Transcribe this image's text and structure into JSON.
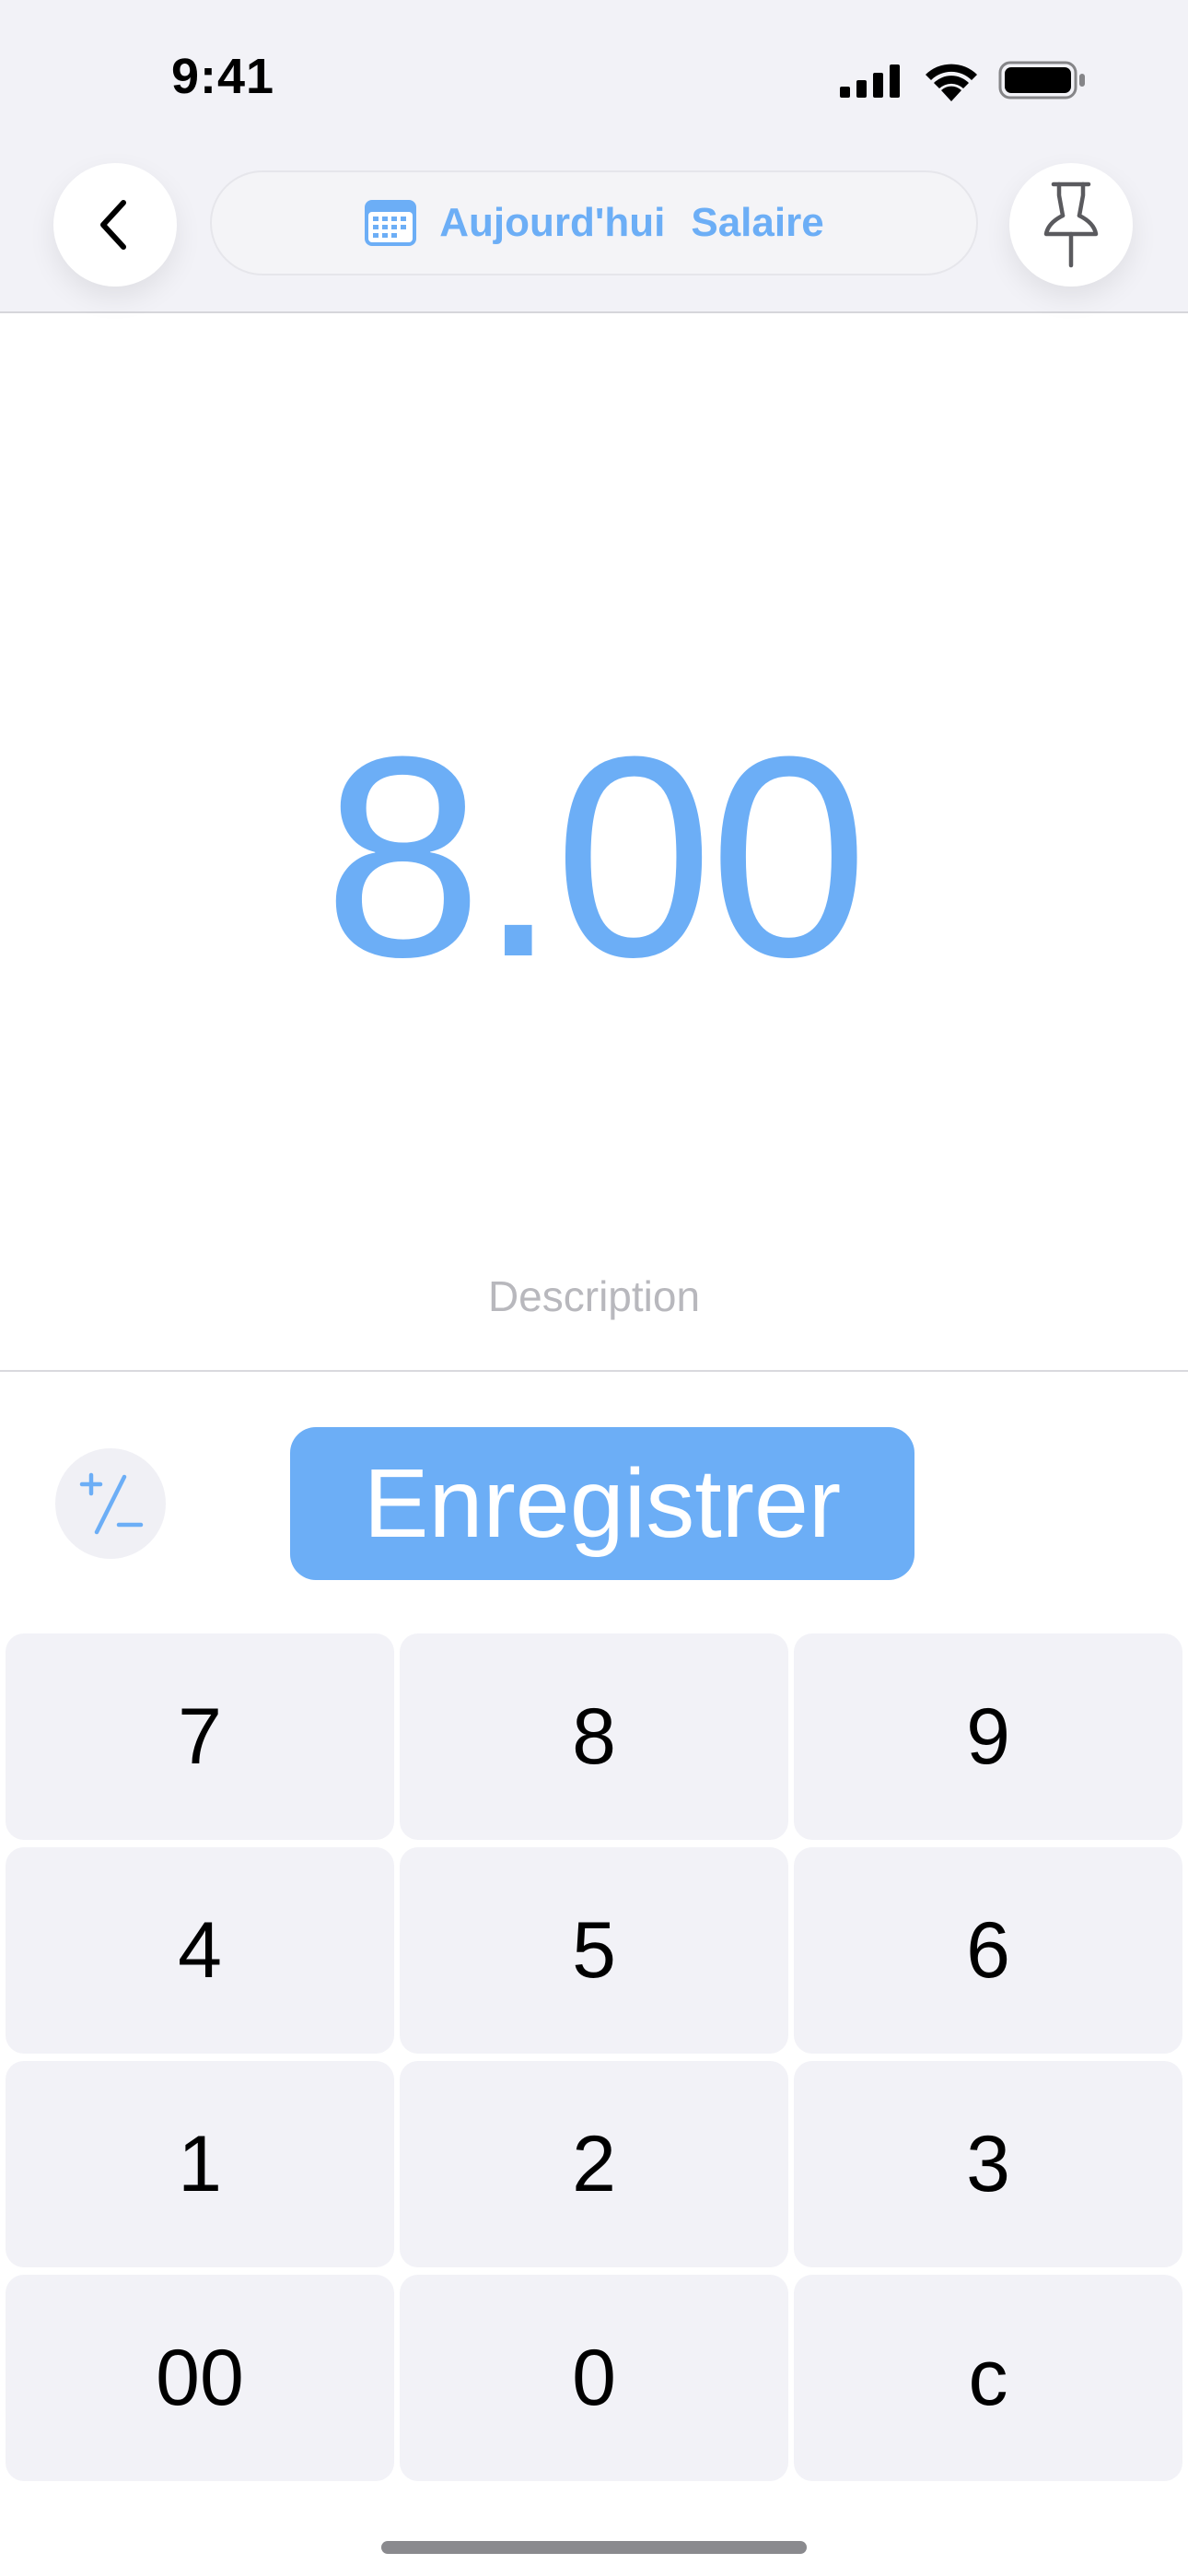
{
  "status_bar": {
    "time": "9:41",
    "icons": [
      "cellular-signal-icon",
      "wifi-icon",
      "battery-icon"
    ]
  },
  "nav": {
    "back_icon": "chevron-left-icon",
    "date_label": "Aujourd'hui",
    "category_label": "Salaire",
    "calendar_icon": "calendar-icon",
    "pin_icon": "pushpin-icon"
  },
  "amount": {
    "value": "8.00"
  },
  "description": {
    "placeholder": "Description"
  },
  "actions": {
    "sign_toggle_icon": "plus-minus-icon",
    "save_label": "Enregistrer"
  },
  "keypad": {
    "keys": [
      "7",
      "8",
      "9",
      "4",
      "5",
      "6",
      "1",
      "2",
      "3",
      "00",
      "0",
      "c"
    ]
  },
  "colors": {
    "accent": "#6caef6",
    "key_background": "#f2f2f7",
    "header_background": "#f2f2f7",
    "placeholder_text": "#b8b8bd"
  }
}
